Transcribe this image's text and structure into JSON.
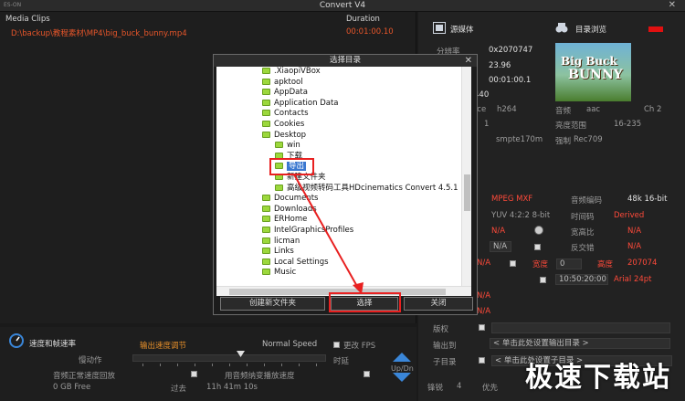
{
  "window": {
    "title": "Convert V4",
    "close": "✕",
    "icon": "ES-ON"
  },
  "clips": {
    "header_name": "Media Clips",
    "header_duration": "Duration",
    "items": [
      {
        "path": "D:\\backup\\教程素材\\MP4\\big_buck_bunny.mp4",
        "duration": "00:01:00.10"
      }
    ]
  },
  "source": {
    "label": "源媒体",
    "preview_label": "目录浏览",
    "rows": [
      {
        "label": "分辨率",
        "value": "0x2070747"
      },
      {
        "label": "",
        "value": "23.96"
      },
      {
        "label": "",
        "value": "00:01:00.1"
      },
      {
        "label": "",
        "value": "440"
      },
      {
        "label": "rce",
        "value": "h264"
      },
      {
        "label": "",
        "value": "1"
      }
    ],
    "audio_label": "音频",
    "audio_codec": "aac",
    "audio_ch": "Ch 2",
    "brightness_label": "亮度范围",
    "brightness_value": "16-235",
    "color_primary": "smpte170m",
    "force_label": "强制",
    "force_value": "Rec709",
    "thumb_title_1": "Big Buck",
    "thumb_title_2": "BUNNY"
  },
  "output": {
    "container": "MPEG MXF",
    "audio_enc_label": "音频编码",
    "audio_enc_value": "48k 16-bit",
    "chroma": "YUV 4:2:2 8-bit",
    "timecode_label": "时间码",
    "timecode_value": "Derived",
    "na": "N/A",
    "aspect_label": "宽高比",
    "deinterlace_label": "反交错",
    "width_label": "宽度",
    "width_value": "0",
    "height_label": "高度",
    "height_value": "207074",
    "time_field": "10:50:20:00",
    "font_value": "Arial 24pt",
    "copyright_label": "版权",
    "output_to_label": "输出到",
    "output_to_value": "< 单击此处设置输出目录 >",
    "subdir_label": "子目录",
    "subdir_value": "< 单击此处设置子目录 >",
    "sharpen_label": "锋锐",
    "sharpen_value": "4",
    "priority_label": "优先"
  },
  "speed": {
    "title": "速度和帧速率",
    "output_speed_label": "输出速度调节",
    "normal_speed": "Normal Speed",
    "slow_label": "慢动作",
    "change_fps": "更改 FPS",
    "delay_label": "时延",
    "normal_play_label": "音频正常速度回放",
    "audio_change_label": "用音频纳变播放速度",
    "free_space": "0 GB Free",
    "past_label": "过去",
    "time_left": "11h 41m 10s",
    "updn": "Up/Dn"
  },
  "dialog": {
    "title": "选择目录",
    "close": "✕",
    "folders": [
      {
        "name": ".XiaopiVBox",
        "level": 0
      },
      {
        "name": "apktool",
        "level": 0
      },
      {
        "name": "AppData",
        "level": 0
      },
      {
        "name": "Application Data",
        "level": 0
      },
      {
        "name": "Contacts",
        "level": 0
      },
      {
        "name": "Cookies",
        "level": 0
      },
      {
        "name": "Desktop",
        "level": 0
      },
      {
        "name": "win",
        "level": 1
      },
      {
        "name": "下载",
        "level": 1
      },
      {
        "name": "导出",
        "level": 1,
        "selected": true
      },
      {
        "name": "新建文件夹",
        "level": 1
      },
      {
        "name": "高级视频转码工具HDcinematics Convert 4.5.1",
        "level": 1
      },
      {
        "name": "Documents",
        "level": 0
      },
      {
        "name": "Downloads",
        "level": 0
      },
      {
        "name": "ERHome",
        "level": 0
      },
      {
        "name": "IntelGraphicsProfiles",
        "level": 0
      },
      {
        "name": "licman",
        "level": 0
      },
      {
        "name": "Links",
        "level": 0
      },
      {
        "name": "Local Settings",
        "level": 0
      },
      {
        "name": "Music",
        "level": 0
      }
    ],
    "new_folder_button": "创建新文件夹",
    "select_button": "选择",
    "close_button": "关闭"
  },
  "annotation_color": "#e82020",
  "watermark": "极速下载站"
}
